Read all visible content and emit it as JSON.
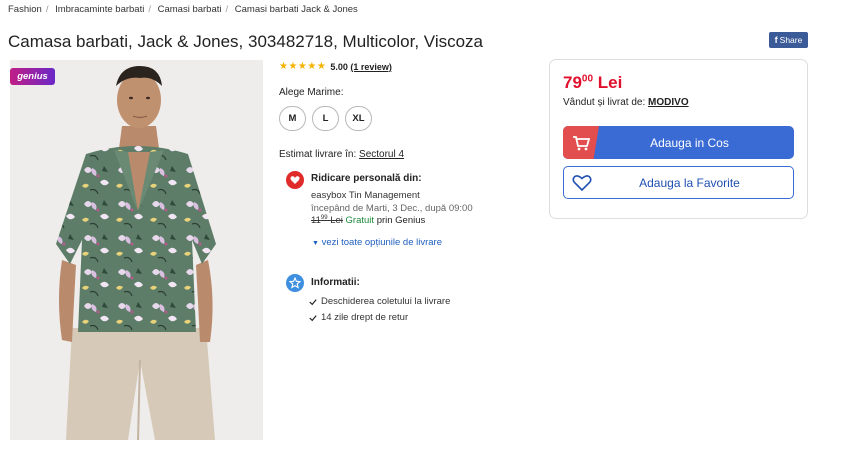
{
  "breadcrumb": [
    "Fashion",
    "Imbracaminte barbati",
    "Camasi barbati",
    "Camasi barbati Jack & Jones"
  ],
  "product": {
    "title": "Camasa barbati, Jack & Jones, 303482718, Multicolor, Viscoza",
    "genius_badge": "genius",
    "share_label": "Share",
    "rating_value": "5.00",
    "rating_reviews": "(1 review)",
    "stars": 5
  },
  "sizes": {
    "label": "Alege Marime:",
    "options": [
      "M",
      "L",
      "XL"
    ]
  },
  "delivery": {
    "estimate_label": "Estimat livrare în:",
    "location": "Sectorul 4",
    "pickup_title": "Ridicare personală din:",
    "pickup_name": "easybox Tin Management",
    "pickup_date": "începând de Marti, 3 Dec., după 09:00",
    "old_price_int": "11",
    "old_price_dec": "99",
    "old_price_cur": "Lei",
    "free_label": "Gratuit",
    "free_suffix": "prin Genius",
    "see_options": "vezi toate opțiunile de livrare"
  },
  "info": {
    "title": "Informatii:",
    "items": [
      "Deschiderea coletului la livrare",
      "14 zile drept de retur"
    ]
  },
  "buy": {
    "price_int": "79",
    "price_dec": "00",
    "currency": "Lei",
    "seller_label": "Vândut și livrat de:",
    "seller_name": "MODIVO",
    "add_to_cart": "Adauga in Cos",
    "add_to_fav": "Adauga la Favorite"
  },
  "colors": {
    "price_red": "#e0102d",
    "cart_blue": "#3a6bd5",
    "cart_red": "#e24d4d",
    "free_green": "#1c8a3a",
    "link_blue": "#1f5fbf"
  }
}
